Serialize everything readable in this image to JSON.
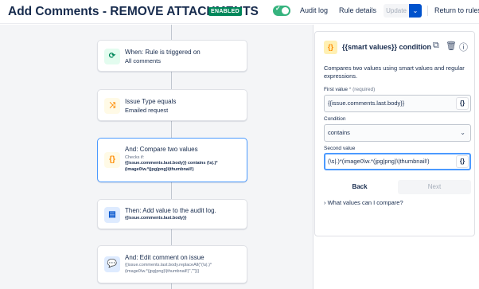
{
  "header": {
    "title": "Add Comments - REMOVE ATTACHMENTS",
    "status_badge": "ENABLED",
    "audit_log": "Audit log",
    "rule_details": "Rule details",
    "update": "Update",
    "return": "Return to rules"
  },
  "steps": [
    {
      "icon": "trigger-icon",
      "title": "When: Rule is triggered on",
      "sub": "All comments"
    },
    {
      "icon": "shuffle-icon",
      "title": "Issue Type equals",
      "sub": "Emailed request"
    },
    {
      "icon": "braces-icon",
      "title": "And: Compare two values",
      "checks_label": "Checks if:",
      "code_line1": "{{issue.comments.last.body}} contains (\\s|.)*",
      "code_line2": "(image0\\w.*(jpg|png)\\|thumbnail!)"
    },
    {
      "icon": "document-icon",
      "title": "Then: Add value to the audit log.",
      "code_line1": "{{issue.comments.last.body}}"
    },
    {
      "icon": "comment-icon",
      "title": "And: Edit comment on issue",
      "code_line1": "{{issue.comments.last.body.replaceAll(\"(\\s|.)*",
      "code_line2": "(image0\\w.*(jpg|png)\\|thumbnail!)\",\"\")}}"
    }
  ],
  "panel": {
    "icon_text": "{}",
    "title": "{{smart values}} condition",
    "description": "Compares two values using smart values and regular expressions.",
    "first_value_label": "First value",
    "required_text": "* (required)",
    "first_value": "{{issue.comments.last.body}}",
    "condition_label": "Condition",
    "condition_value": "contains",
    "second_value_label": "Second value",
    "second_value": "(\\s|.)*(image0\\w.*(jpg|png)\\|thumbnail!)",
    "brace_btn": "{}",
    "back": "Back",
    "next": "Next",
    "expander": "What values can I compare?"
  }
}
